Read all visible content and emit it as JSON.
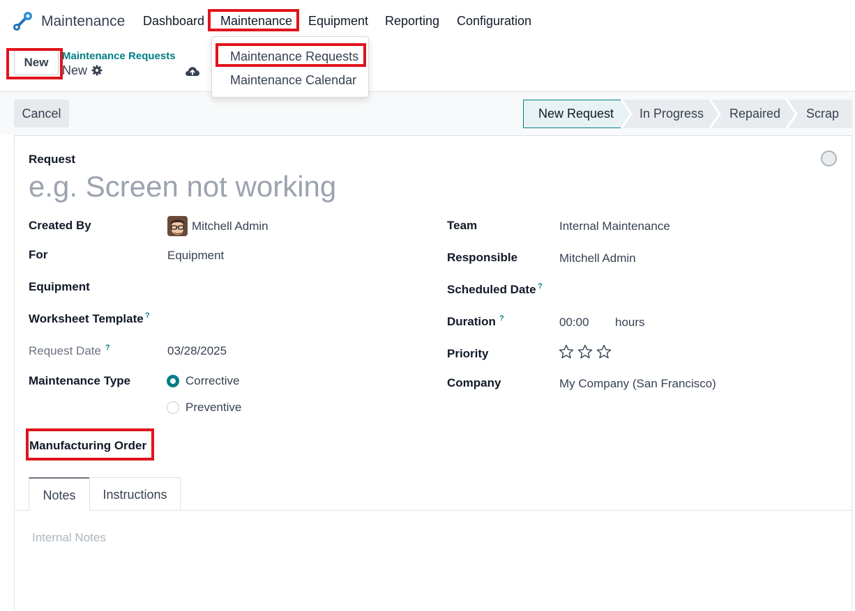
{
  "navbar": {
    "app_name": "Maintenance",
    "menu": [
      "Dashboard",
      "Maintenance",
      "Equipment",
      "Reporting",
      "Configuration"
    ]
  },
  "dropdown": {
    "items": [
      "Maintenance Requests",
      "Maintenance Calendar"
    ]
  },
  "control_panel": {
    "new_button": "New",
    "breadcrumb_parent": "Maintenance Requests",
    "breadcrumb_current": "New",
    "icons": [
      "gear-icon",
      "cloud-upload-icon"
    ]
  },
  "statusbar": {
    "cancel_button": "Cancel",
    "stages": [
      "New Request",
      "In Progress",
      "Repaired",
      "Scrap"
    ],
    "active_stage": "New Request"
  },
  "form": {
    "request_label": "Request",
    "request_placeholder": "e.g. Screen not working",
    "left": {
      "created_by_label": "Created By",
      "created_by_value": "Mitchell Admin",
      "for_label": "For",
      "for_value": "Equipment",
      "equipment_label": "Equipment",
      "worksheet_label": "Worksheet Template",
      "request_date_label": "Request Date",
      "request_date_value": "03/28/2025",
      "maintenance_type_label": "Maintenance Type",
      "maintenance_type_options": [
        "Corrective",
        "Preventive"
      ],
      "maintenance_type_selected": "Corrective",
      "manufacturing_order_label": "Manufacturing Order"
    },
    "right": {
      "team_label": "Team",
      "team_value": "Internal Maintenance",
      "responsible_label": "Responsible",
      "responsible_value": "Mitchell Admin",
      "scheduled_date_label": "Scheduled Date",
      "duration_label": "Duration",
      "duration_value": "00:00",
      "duration_unit": "hours",
      "priority_label": "Priority",
      "priority_stars": 0,
      "priority_max": 3,
      "company_label": "Company",
      "company_value": "My Company (San Francisco)"
    },
    "help_mark": "?"
  },
  "notebook": {
    "tabs": [
      "Notes",
      "Instructions"
    ],
    "active_tab": "Notes",
    "notes_placeholder": "Internal Notes"
  },
  "colors": {
    "accent": "#017e84",
    "highlight_box": "#e0141c",
    "active_stage_bg": "#e6f2f3"
  }
}
